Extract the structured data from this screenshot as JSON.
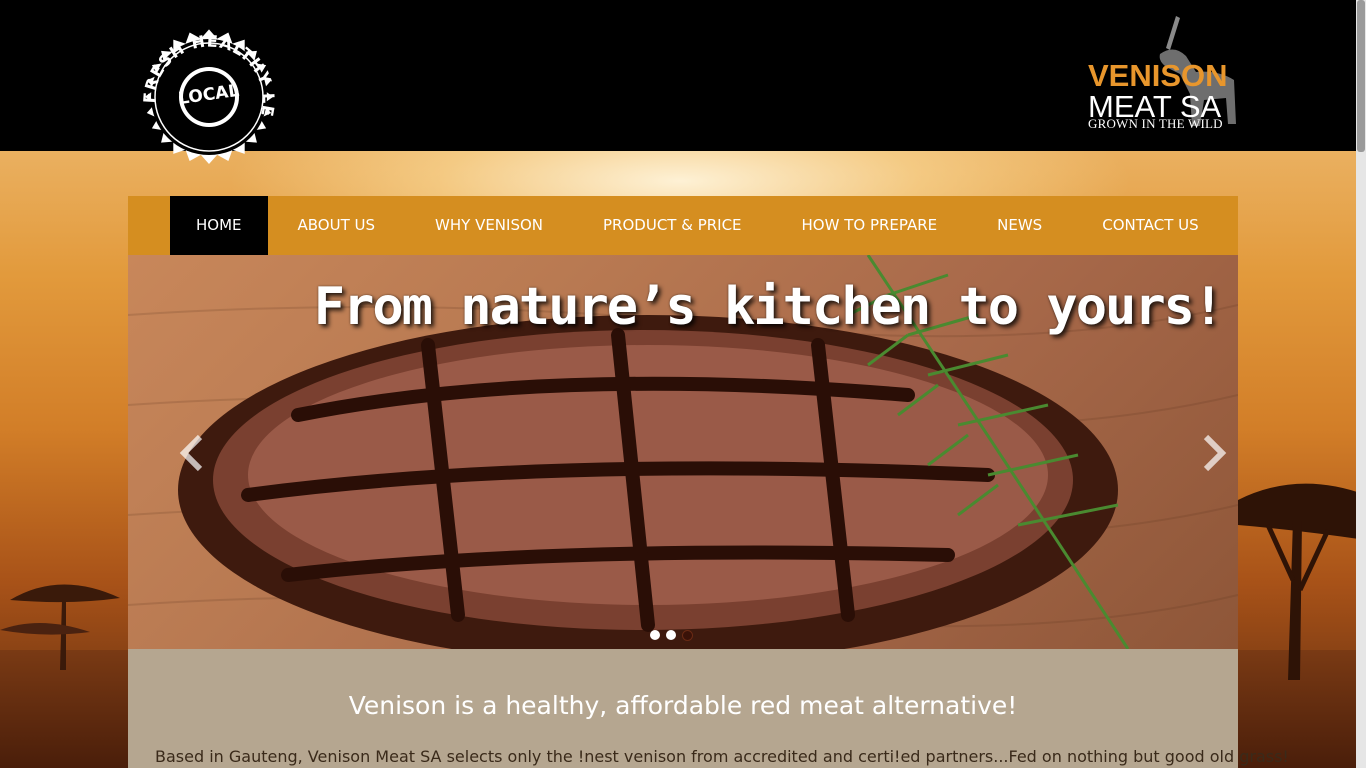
{
  "header": {
    "badge": {
      "outer_text": "FRESH HEALTHY LEAN TASTY",
      "center_text": "LOCAL"
    },
    "brand": {
      "line1": "VENISON",
      "line2": "MEAT SA",
      "tagline": "GROWN IN THE WILD"
    }
  },
  "nav": {
    "items": [
      {
        "label": "HOME",
        "active": true
      },
      {
        "label": "ABOUT US"
      },
      {
        "label": "WHY VENISON"
      },
      {
        "label": "PRODUCT & PRICE"
      },
      {
        "label": "HOW TO PREPARE"
      },
      {
        "label": "NEWS"
      },
      {
        "label": "CONTACT US"
      }
    ]
  },
  "slider": {
    "headline": "From nature’s kitchen to yours!",
    "prev_icon": "chevron-left-icon",
    "next_icon": "chevron-right-icon",
    "slide_count": 3,
    "active_slide": 3
  },
  "content": {
    "heading": "Venison is a healthy, affordable red meat alternative!",
    "intro": "Based in Gauteng, Venison Meat SA selects only the !nest venison from accredited and certi!ed partners...Fed on nothing but good old grass!"
  },
  "colors": {
    "nav_bg": "#d58e20",
    "brand_orange": "#e8962c",
    "content_bg": "#b5a690"
  }
}
